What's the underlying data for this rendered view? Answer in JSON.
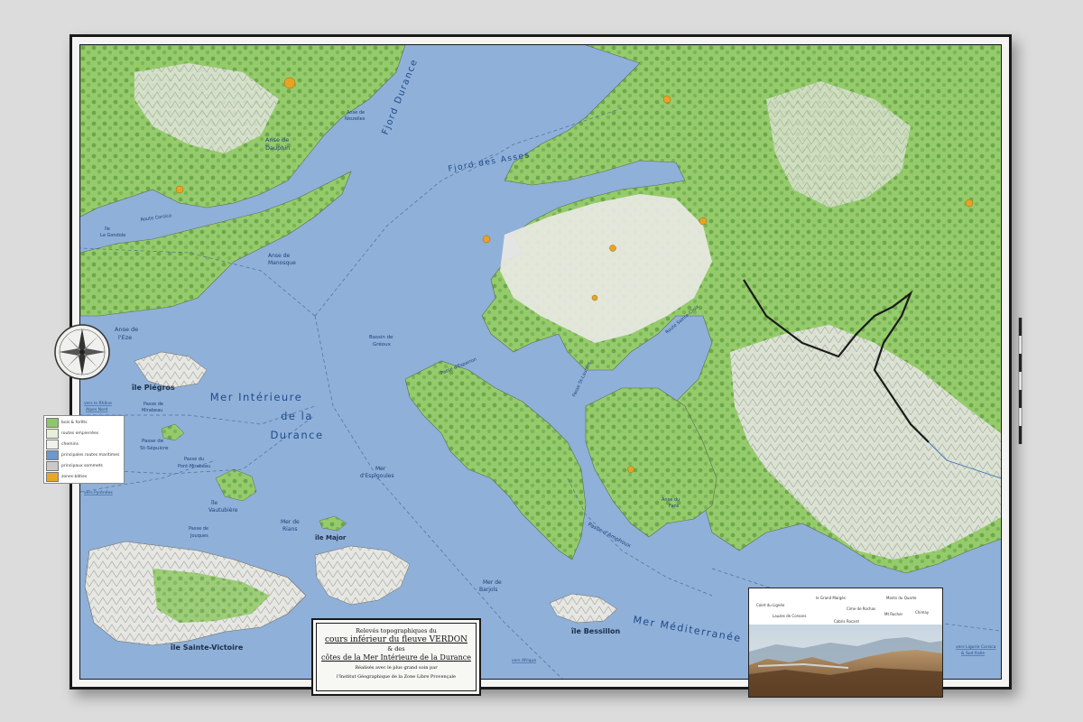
{
  "sea_labels": {
    "interior_sea_line1": "Mer Intérieure",
    "interior_sea_line2": "de la",
    "interior_sea_line3": "Durance",
    "mediterranean": "Mer Méditerranée",
    "fjord_durance": "Fjord Durance",
    "fjord_asses": "Fjord des Asses"
  },
  "islands": {
    "piegros": "île Piégros",
    "sainte_victoire": "île Sainte-Victoire",
    "bessillon": "île Bessillon",
    "major": "île Major",
    "vautubiere_line1": "île",
    "vautubiere_line2": "Vautubière",
    "gondole_line1": "île",
    "gondole_line2": "La Gondole"
  },
  "coves": {
    "dauphin_line1": "Anse de",
    "dauphin_line2": "Dauphin",
    "manosque_line1": "Anse de",
    "manosque_line2": "Manosque",
    "eze_line1": "Anse de",
    "eze_line2": "l'Eze",
    "niozelles_line1": "Anse de",
    "niozelles_line2": "Niozelles",
    "fans_line1": "Anse du",
    "fans_line2": "Fans"
  },
  "passes": {
    "st_sepulcre_line1": "Passe de",
    "st_sepulcre_line2": "St-Sépulcre",
    "pont_mirabeau_line1": "Passe du",
    "pont_mirabeau_line2": "Pont-Mirabeau",
    "jouques_line1": "Passe de",
    "jouques_line2": "Jouques",
    "mirabeau_line1": "Passe de",
    "mirabeau_line2": "Mirabeau",
    "amphoux": "Passe d'Amphoux",
    "esparron": "Passe d'Esparron"
  },
  "seas": {
    "espigoules_line1": "Mer",
    "espigoules_line2": "d'Espigoules",
    "rians_line1": "Mer de",
    "rians_line2": "Rians",
    "barjols_line1": "Mer de",
    "barjols_line2": "Barjols",
    "greoux_line1": "Bassin de",
    "greoux_line2": "Gréoux"
  },
  "routes": {
    "corsica": "Route Corsica",
    "sainte_croix": "Route Sainte-Croix",
    "st_laurent": "Passe St-Laurent"
  },
  "external_links": {
    "arles_line1": "vers le Rhône",
    "arles_line2": "Alpes Nord",
    "pyrenees": "vers Pyrénées",
    "afrique": "vers Afrique",
    "ligurie_line1": "vers Ligurie Corsica",
    "ligurie_line2": "& Sud Italie"
  },
  "legend": [
    {
      "label": "bois & forêts",
      "color": "#8fc66a"
    },
    {
      "label": "routes empierrées",
      "color": "#e7eedc"
    },
    {
      "label": "chemins",
      "color": "#f1f1ec"
    },
    {
      "label": "principales routes maritimes",
      "color": "#6d97cf"
    },
    {
      "label": "principaux sommets",
      "color": "#c9c9c9"
    },
    {
      "label": "zones bâties",
      "color": "#e7a72b"
    }
  ],
  "cartouche": {
    "line1": "Relevés topographiques du",
    "line2": "cours inférieur du fleuve VERDON",
    "line3": "& des",
    "line4": "côtes de la Mer Intérieure de la Durance",
    "line5": "Réalisés avec le plus grand soin par",
    "line6": "l'Institut Géographique de la Zone Libre Provençale"
  },
  "inset_labels": [
    "Colet du Lignée",
    "Lauzes de Corsons",
    "le Grand Margès",
    "Cime de Rochas",
    "Cabris Rocard",
    "Monts du Quarte",
    "Mt Rocher",
    "Chimay"
  ],
  "colors": {
    "sea": "#8fb0d8",
    "land_light": "#e6e6e0",
    "forest": "#8cc462",
    "forest_dark": "#5c9a3e",
    "town": "#e8a324",
    "route": "#4f6f9c"
  }
}
